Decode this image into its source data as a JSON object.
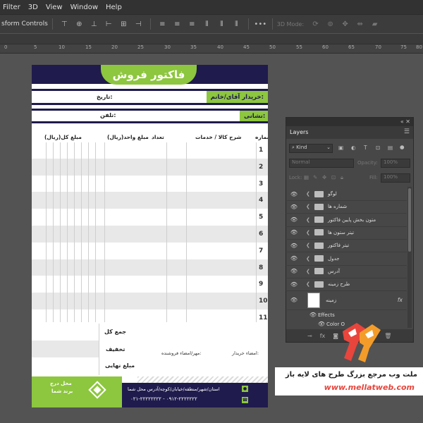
{
  "menubar": {
    "items": [
      "Filter",
      "3D",
      "View",
      "Window",
      "Help"
    ]
  },
  "options_bar": {
    "transform_controls": "sform Controls",
    "mode_3d": "3D Mode:"
  },
  "ruler": {
    "labels": [
      "0",
      "5",
      "10",
      "15",
      "20",
      "25",
      "30",
      "35",
      "40",
      "45",
      "50",
      "55",
      "60",
      "65",
      "70",
      "75",
      "80"
    ]
  },
  "invoice": {
    "title": "فاکتور فروش",
    "buyer_label": "خریدار آقای/خانم:",
    "date_label": "تاریخ:",
    "address_label": "نشانی:",
    "phone_label": "تلفن:",
    "columns": {
      "number": "شماره",
      "description": "شرح کالا / خدمات",
      "quantity": "تعداد",
      "unit_price": "مبلغ واحد(ریال)",
      "total_price": "مبلغ کل(ریال)"
    },
    "rows": [
      "1",
      "2",
      "3",
      "4",
      "5",
      "6",
      "7",
      "8",
      "9",
      "10",
      "11"
    ],
    "totals": {
      "grand_total": "جمع کل",
      "discount": "تخفیف",
      "final_amount": "مبلغ نهایی"
    },
    "buyer_signature": "امضاء خریدار:",
    "seller_signature": "مهر/امضاء فروشنده:",
    "footer_address": "استان/شهر/منطقه/خیابان/کوچه/آدرس محل شما",
    "footer_phone": "۰۲۱-۲۲۲۲۲۲۲۲ - ۰۹۱۲-۲۲۲۲۲۲۲",
    "brand_placeholder_line1": "محل درج",
    "brand_placeholder_line2": "برند شما"
  },
  "layers_panel": {
    "tab_label": "Layers",
    "kind_filter": "Kind",
    "blend_mode": "Normal",
    "opacity_label": "Opacity:",
    "opacity_value": "100%",
    "lock_label": "Lock:",
    "fill_label": "Fill:",
    "fill_value": "100%",
    "layers": [
      {
        "name": "لوگو"
      },
      {
        "name": "شماره ها"
      },
      {
        "name": "متون بخش پایین فاکتور"
      },
      {
        "name": "تیتر ستون ها"
      },
      {
        "name": "تیتر فاکتور"
      },
      {
        "name": "جدول"
      },
      {
        "name": "آدرس"
      },
      {
        "name": "طرح زمینه"
      }
    ],
    "background_layer": "زمینه",
    "fx_label": "fx",
    "effects_label": "Effects",
    "color_overlay_label": "Color O"
  },
  "watermark": {
    "line1": "ملت وب مرجع بزرگ طرح های لایه باز",
    "line2": "www.mellatweb.com"
  },
  "colors": {
    "navy": "#1f1b4d",
    "green": "#8dc63f",
    "logo_red": "#e8453c",
    "logo_orange": "#f39c2a"
  }
}
